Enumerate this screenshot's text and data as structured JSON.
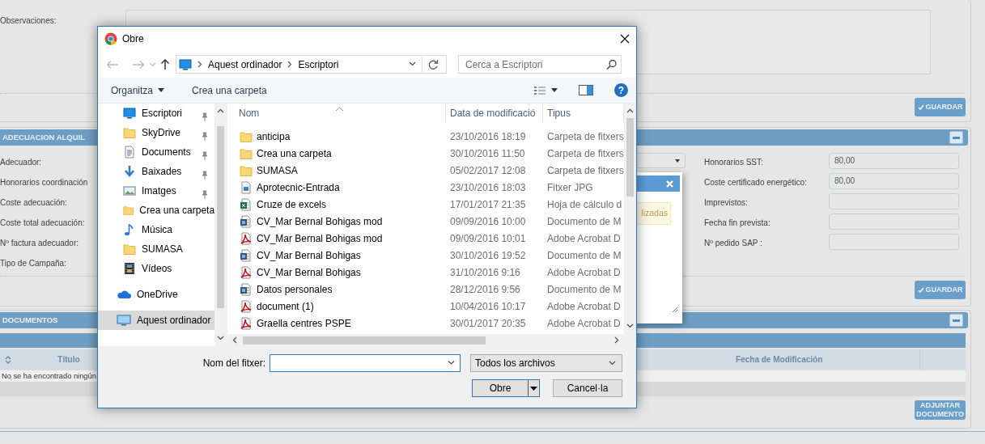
{
  "background": {
    "observations": {
      "label": "Observaciones:"
    },
    "top_save_button": "GUARDAR",
    "adecuacion": {
      "title": "ADECUACION ALQUIL",
      "left_labels": [
        "Adecuador:",
        "Honorarios coordinación",
        "Coste adecuación:",
        "Coste total adecuación:",
        "Nº factura adecuador:",
        "Tipo de Campaña:"
      ],
      "right_fields": [
        {
          "label": "Honorarios SST:",
          "value": "80,00"
        },
        {
          "label": "Coste certificado energético:",
          "value": "80,00"
        },
        {
          "label": "Imprevistos:"
        },
        {
          "label": "Fecha fin prevista:"
        },
        {
          "label": "Nº pedido SAP :"
        }
      ],
      "save_button": "GUARDAR"
    },
    "popup": {
      "alert": "lizadas"
    },
    "documentos": {
      "title": "DOCUMENTOS",
      "columns": [
        "Título",
        "Fecha de Modificación"
      ],
      "empty_message": "No se ha encontrado ningún",
      "attach_button": "ADJUNTAR DOCUMENTO"
    }
  },
  "dialog": {
    "title": "Obre",
    "breadcrumb": [
      "Aquest ordinador",
      "Escriptori"
    ],
    "search": {
      "placeholder": "Cerca a Escriptori"
    },
    "toolbar": {
      "organize": "Organitza",
      "new_folder": "Crea una carpeta",
      "help": "?"
    },
    "nav": {
      "quick_access": [
        {
          "label": "Escriptori",
          "kind": "desktop",
          "pinned": true,
          "selected": false
        },
        {
          "label": "SkyDrive",
          "kind": "folder",
          "pinned": true,
          "selected": false
        },
        {
          "label": "Documents",
          "kind": "documents",
          "pinned": true,
          "selected": false
        },
        {
          "label": "Baixades",
          "kind": "downloads",
          "pinned": true,
          "selected": false
        },
        {
          "label": "Imatges",
          "kind": "pictures",
          "pinned": true,
          "selected": false
        },
        {
          "label": "Crea una carpeta",
          "kind": "folder",
          "pinned": false,
          "selected": false
        },
        {
          "label": "Música",
          "kind": "music",
          "pinned": false,
          "selected": false
        },
        {
          "label": "SUMASA",
          "kind": "folder",
          "pinned": false,
          "selected": false
        },
        {
          "label": "Vídeos",
          "kind": "videos",
          "pinned": false,
          "selected": false
        }
      ],
      "locations": [
        {
          "label": "OneDrive",
          "kind": "cloud",
          "selected": false
        },
        {
          "label": "Aquest ordinador",
          "kind": "computer",
          "selected": true
        }
      ]
    },
    "columns": [
      "Nom",
      "Data de modificació",
      "Tipus"
    ],
    "files": [
      {
        "name": "anticipa",
        "modified": "23/10/2016 18:19",
        "type": "Carpeta de fitxers",
        "kind": "folder"
      },
      {
        "name": "Crea una carpeta",
        "modified": "30/10/2016 11:50",
        "type": "Carpeta de fitxers",
        "kind": "folder"
      },
      {
        "name": "SUMASA",
        "modified": "05/02/2017 12:08",
        "type": "Carpeta de fitxers",
        "kind": "folder"
      },
      {
        "name": "Aprotecnic-Entrada",
        "modified": "23/10/2016 18:03",
        "type": "Fitxer JPG",
        "kind": "image"
      },
      {
        "name": "Cruze de excels",
        "modified": "17/01/2017 21:35",
        "type": "Hoja de cálculo d",
        "kind": "spreadsheet"
      },
      {
        "name": "CV_Mar Bernal Bohigas mod",
        "modified": "09/09/2016 10:00",
        "type": "Documento de M",
        "kind": "word"
      },
      {
        "name": "CV_Mar Bernal Bohigas mod",
        "modified": "09/09/2016 10:01",
        "type": "Adobe Acrobat D",
        "kind": "pdf"
      },
      {
        "name": "CV_Mar Bernal Bohigas",
        "modified": "30/10/2016 19:52",
        "type": "Documento de M",
        "kind": "word"
      },
      {
        "name": "CV_Mar Bernal Bohigas",
        "modified": "31/10/2016 9:16",
        "type": "Adobe Acrobat D",
        "kind": "pdf"
      },
      {
        "name": "Datos personales",
        "modified": "28/12/2016 9:56",
        "type": "Documento de M",
        "kind": "word"
      },
      {
        "name": "document (1)",
        "modified": "10/04/2016 10:17",
        "type": "Adobe Acrobat D",
        "kind": "pdf"
      },
      {
        "name": "Graella centres PSPE",
        "modified": "30/01/2017 20:35",
        "type": "Adobe Acrobat D",
        "kind": "pdf"
      }
    ],
    "filename": {
      "label": "Nom del fitxer:"
    },
    "file_type": "Todos los archivos",
    "buttons": {
      "open": "Obre",
      "cancel": "Cancel·la"
    }
  }
}
